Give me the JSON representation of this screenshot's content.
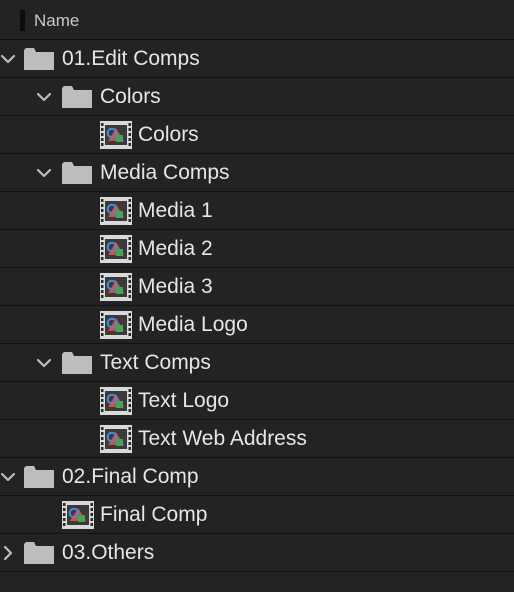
{
  "header": {
    "name_label": "Name"
  },
  "colors": {
    "background": "#232323",
    "divider": "#121212",
    "text": "#e6e6e6",
    "folder": "#bdbdbd",
    "comp_frame": "#d9d9d9"
  },
  "items": [
    {
      "label": "01.Edit Comps",
      "type": "folder",
      "depth": 0,
      "expanded": true,
      "icon": "folder-icon"
    },
    {
      "label": "Colors",
      "type": "folder",
      "depth": 1,
      "expanded": true,
      "icon": "folder-icon"
    },
    {
      "label": "Colors",
      "type": "composition",
      "depth": 2,
      "icon": "composition-icon"
    },
    {
      "label": "Media Comps",
      "type": "folder",
      "depth": 1,
      "expanded": true,
      "icon": "folder-icon"
    },
    {
      "label": "Media 1",
      "type": "composition",
      "depth": 2,
      "icon": "composition-icon"
    },
    {
      "label": "Media 2",
      "type": "composition",
      "depth": 2,
      "icon": "composition-icon"
    },
    {
      "label": "Media 3",
      "type": "composition",
      "depth": 2,
      "icon": "composition-icon"
    },
    {
      "label": "Media Logo",
      "type": "composition",
      "depth": 2,
      "icon": "composition-icon"
    },
    {
      "label": "Text Comps",
      "type": "folder",
      "depth": 1,
      "expanded": true,
      "icon": "folder-icon"
    },
    {
      "label": "Text Logo",
      "type": "composition",
      "depth": 2,
      "icon": "composition-icon"
    },
    {
      "label": "Text Web Address",
      "type": "composition",
      "depth": 2,
      "icon": "composition-icon"
    },
    {
      "label": "02.Final Comp",
      "type": "folder",
      "depth": 0,
      "expanded": true,
      "icon": "folder-icon"
    },
    {
      "label": "Final Comp",
      "type": "composition",
      "depth": 1,
      "icon": "composition-icon"
    },
    {
      "label": "03.Others",
      "type": "folder",
      "depth": 0,
      "expanded": false,
      "icon": "folder-icon"
    }
  ]
}
